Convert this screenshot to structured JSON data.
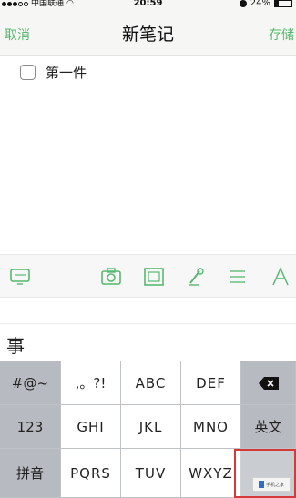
{
  "status_bar": {
    "carrier": "中国联通",
    "time": "20:59",
    "battery": "24%",
    "battery_level": 0.24
  },
  "nav": {
    "cancel_label": "取消",
    "title": "新笔记",
    "save_label": "存储"
  },
  "note": {
    "todo_text": "第一件"
  },
  "toolbar": {
    "icons": [
      "keyboard-toggle-icon",
      "camera-icon",
      "image-icon",
      "pen-icon",
      "list-icon",
      "text-format-icon"
    ]
  },
  "candidate_bar": {
    "candidate": "事"
  },
  "keyboard": {
    "rows": [
      [
        "#@~",
        ",。?!",
        "ABC",
        "DEF",
        "delete"
      ],
      [
        "123",
        "GHI",
        "JKL",
        "MNO",
        "英文"
      ],
      [
        "拼音",
        "PQRS",
        "TUV",
        "WXYZ",
        ""
      ]
    ]
  },
  "watermark": {
    "text": "手机之家"
  },
  "colors": {
    "accent": "#57b96f",
    "keyboard_bg": "#c9ccd0",
    "highlight": "#d53a3a"
  }
}
